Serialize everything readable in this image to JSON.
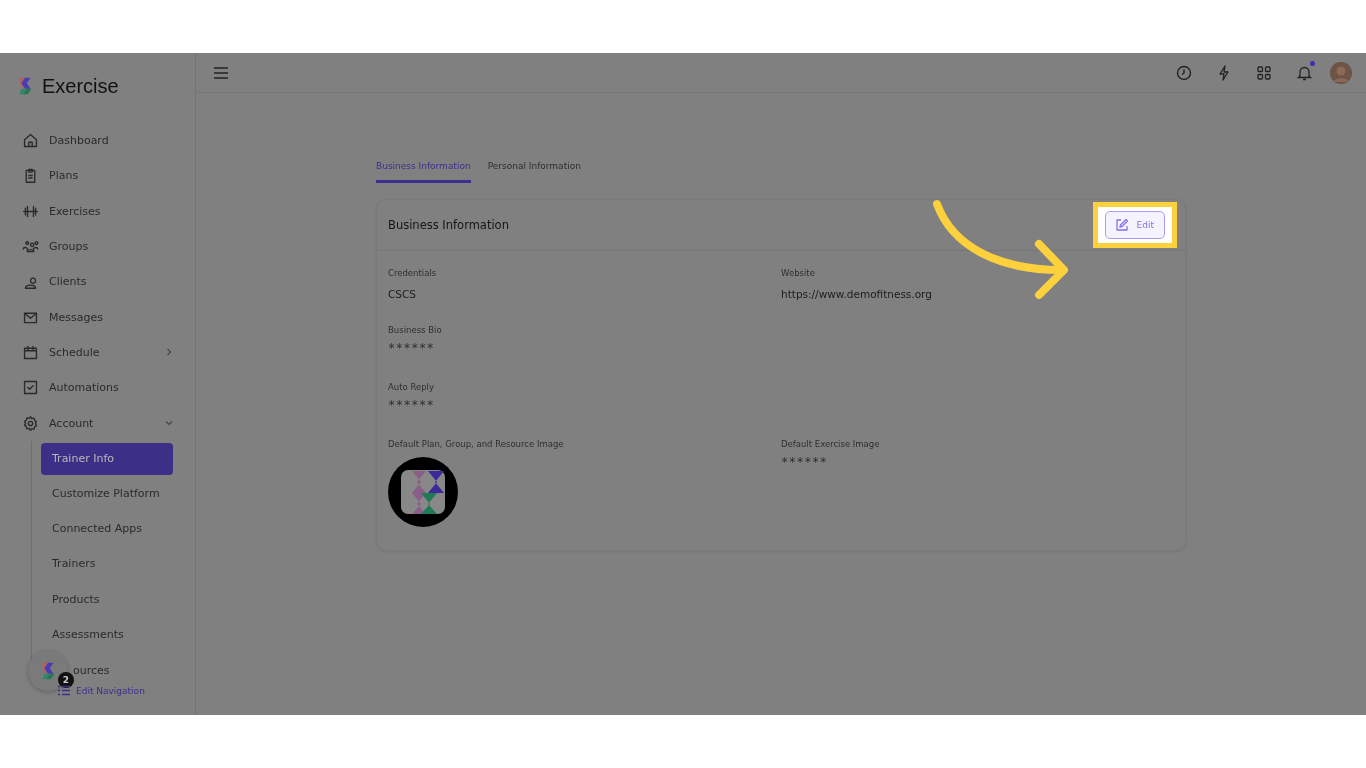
{
  "sidebar": {
    "brand": "Exercise",
    "items": [
      {
        "label": "Dashboard"
      },
      {
        "label": "Plans"
      },
      {
        "label": "Exercises"
      },
      {
        "label": "Groups"
      },
      {
        "label": "Clients"
      },
      {
        "label": "Messages"
      },
      {
        "label": "Schedule",
        "expanded": false
      },
      {
        "label": "Automations"
      },
      {
        "label": "Account",
        "expanded": true,
        "children": [
          {
            "label": "Trainer Info",
            "selected": true
          },
          {
            "label": "Customize Platform",
            "selected": false
          },
          {
            "label": "Connected Apps",
            "selected": false
          },
          {
            "label": "Trainers",
            "selected": false
          },
          {
            "label": "Products",
            "selected": false
          },
          {
            "label": "Assessments",
            "selected": false
          },
          {
            "label": "ources",
            "selected": false,
            "kind": "partly_hidden"
          }
        ]
      }
    ],
    "help_badge": "2",
    "edit_navigation": "Edit Navigation"
  },
  "topbar": {
    "notification_dot": true
  },
  "tabs": [
    {
      "label": "Business Information",
      "selected": true
    },
    {
      "label": "Personal Information",
      "selected": false
    }
  ],
  "card": {
    "title": "Business Information",
    "edit_button": "Edit",
    "fields": [
      {
        "label": "Credentials",
        "value": "CSCS"
      },
      {
        "label": "Website",
        "value": "https://www.demofitness.org"
      },
      {
        "label": "Business Bio",
        "value": "******",
        "kind": "hidden"
      },
      {
        "kind": "spacer"
      },
      {
        "label": "Auto Reply",
        "value": "******",
        "kind": "hidden"
      },
      {
        "kind": "spacer"
      },
      {
        "label": "Default Plan, Group, and Resource Image",
        "kind": "image"
      },
      {
        "label": "Default Exercise Image",
        "value": "******",
        "kind": "hidden"
      }
    ]
  }
}
